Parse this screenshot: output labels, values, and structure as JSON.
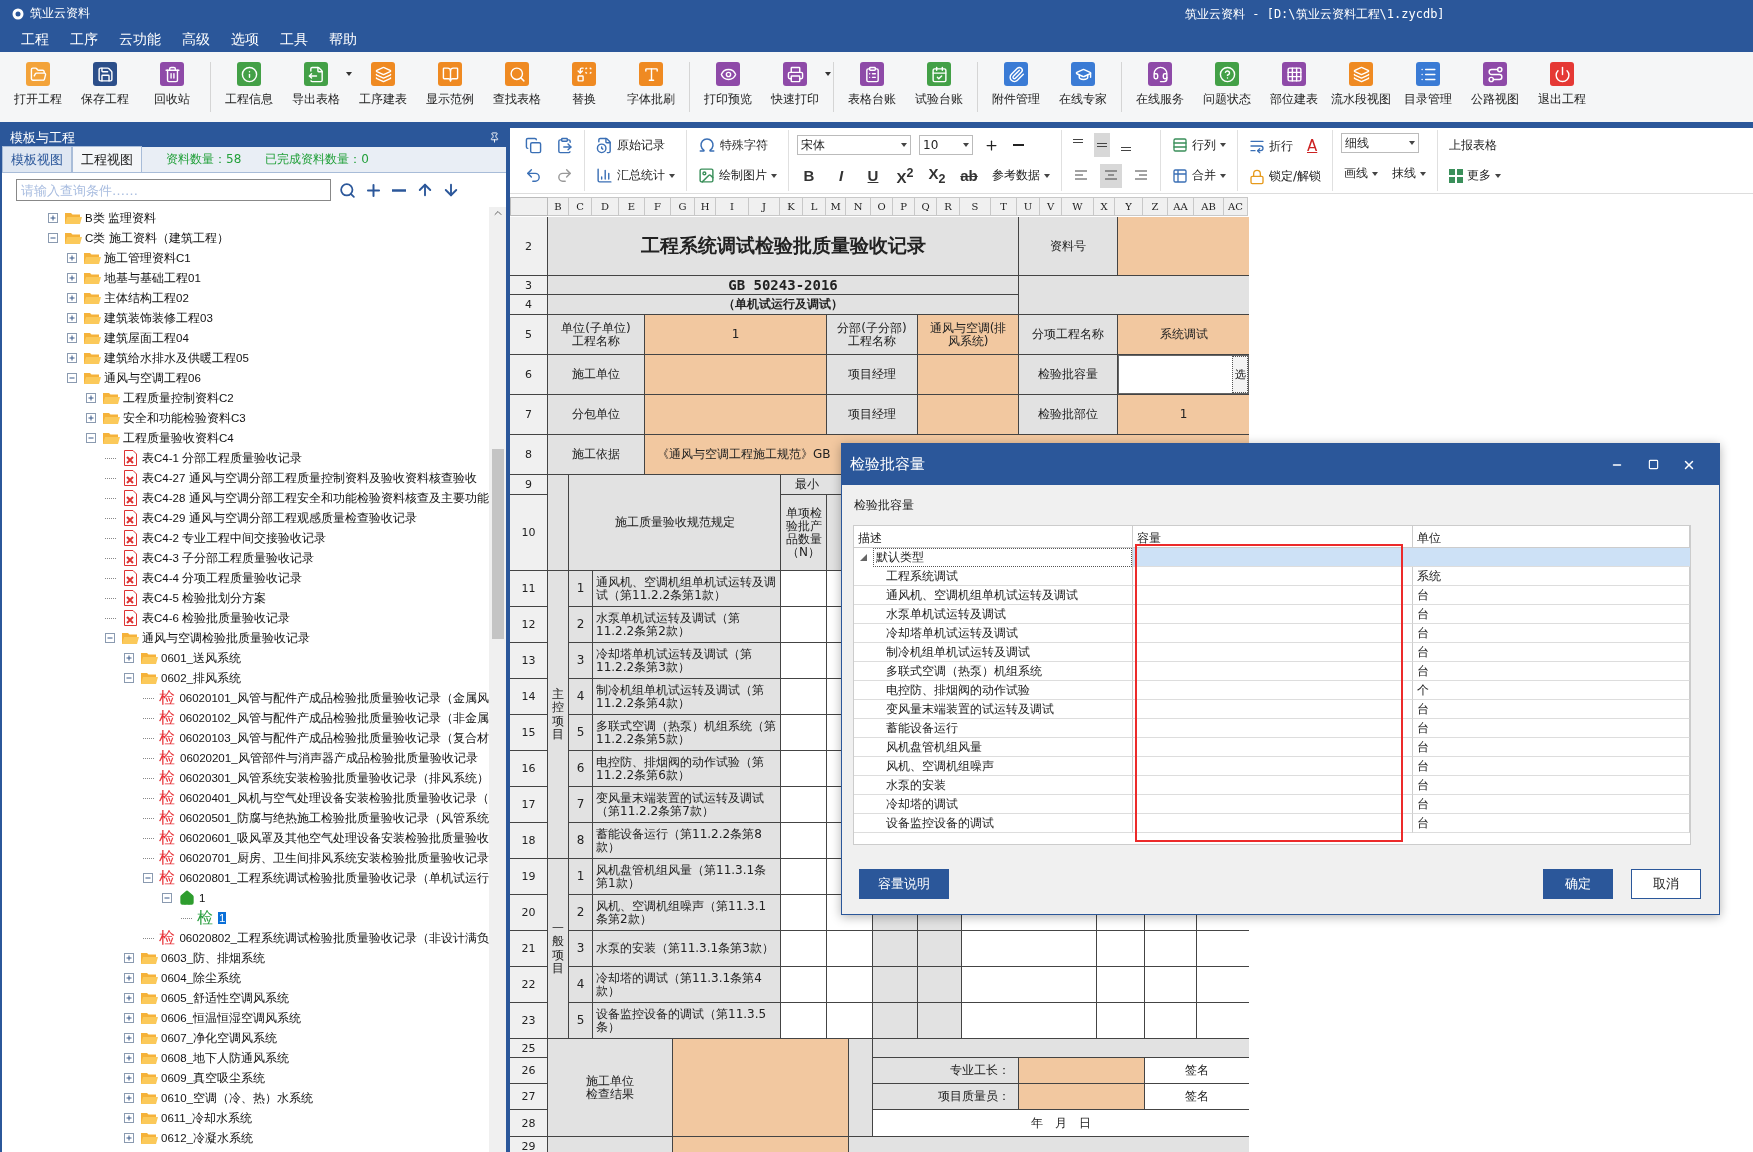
{
  "title_bar": {
    "app_name": "筑业云资料",
    "document": "筑业云资料 - [D:\\筑业云资料工程\\1.zycdb]"
  },
  "menu": [
    "工程",
    "工序",
    "云功能",
    "高级",
    "选项",
    "工具",
    "帮助"
  ],
  "toolbar": [
    {
      "label": "打开工程"
    },
    {
      "label": "保存工程"
    },
    {
      "label": "回收站"
    },
    {
      "label": "工程信息"
    },
    {
      "label": "导出表格",
      "has_menu": true
    },
    {
      "label": "工序建表"
    },
    {
      "label": "显示范例"
    },
    {
      "label": "查找表格"
    },
    {
      "label": "替换"
    },
    {
      "label": "字体批刷"
    },
    {
      "label": "打印预览"
    },
    {
      "label": "快速打印",
      "has_menu": true
    },
    {
      "label": "表格台账"
    },
    {
      "label": "试验台账"
    },
    {
      "label": "附件管理"
    },
    {
      "label": "在线专家"
    },
    {
      "label": "在线服务"
    },
    {
      "label": "问题状态"
    },
    {
      "label": "部位建表"
    },
    {
      "label": "流水段视图"
    },
    {
      "label": "目录管理"
    },
    {
      "label": "公路视图"
    },
    {
      "label": "退出工程"
    }
  ],
  "left_panel": {
    "title": "模板与工程",
    "tabs": [
      {
        "label": "模板视图",
        "selected": true
      },
      {
        "label": "工程视图",
        "selected": false
      }
    ],
    "stats": [
      "资料数量：58",
      "已完成资料数量：0"
    ],
    "search": {
      "placeholder": "请输入查询条件……"
    },
    "tree": [
      {
        "kind": "folder",
        "label": "B类 监理资料",
        "expanded": false,
        "selected": false
      },
      {
        "kind": "folder",
        "label": "C类 施工资料（建筑工程）",
        "expanded": true,
        "selected": false,
        "children": [
          {
            "kind": "folder",
            "label": "施工管理资料C1",
            "expanded": false,
            "selected": false
          },
          {
            "kind": "folder",
            "label": "地基与基础工程01",
            "expanded": false,
            "selected": false
          },
          {
            "kind": "folder",
            "label": "主体结构工程02",
            "expanded": false,
            "selected": false
          },
          {
            "kind": "folder",
            "label": "建筑装饰装修工程03",
            "expanded": false,
            "selected": false
          },
          {
            "kind": "folder",
            "label": "建筑屋面工程04",
            "expanded": false,
            "selected": false
          },
          {
            "kind": "folder",
            "label": "建筑给水排水及供暖工程05",
            "expanded": false,
            "selected": false
          },
          {
            "kind": "folder",
            "label": "通风与空调工程06",
            "expanded": true,
            "selected": false,
            "children": [
              {
                "kind": "folder",
                "label": "工程质量控制资料C2",
                "expanded": false,
                "selected": false
              },
              {
                "kind": "folder",
                "label": "安全和功能检验资料C3",
                "expanded": false,
                "selected": false
              },
              {
                "kind": "folder",
                "label": "工程质量验收资料C4",
                "expanded": true,
                "selected": false,
                "children": [
                  {
                    "kind": "form",
                    "label": "表C4-1 分部工程质量验收记录",
                    "selected": false
                  },
                  {
                    "kind": "form",
                    "label": "表C4-27 通风与空调分部工程质量控制资料及验收资料核查验收",
                    "selected": false
                  },
                  {
                    "kind": "form",
                    "label": "表C4-28 通风与空调分部工程安全和功能检验资料核查及主要功能",
                    "selected": false
                  },
                  {
                    "kind": "form",
                    "label": "表C4-29 通风与空调分部工程观感质量检查验收记录",
                    "selected": false
                  },
                  {
                    "kind": "form",
                    "label": "表C4-2 专业工程中间交接验收记录",
                    "selected": false
                  },
                  {
                    "kind": "form",
                    "label": "表C4-3 子分部工程质量验收记录",
                    "selected": false
                  },
                  {
                    "kind": "form",
                    "label": "表C4-4 分项工程质量验收记录",
                    "selected": false
                  },
                  {
                    "kind": "form",
                    "label": "表C4-5 检验批划分方案",
                    "selected": false
                  },
                  {
                    "kind": "form",
                    "label": "表C4-6 检验批质量验收记录",
                    "selected": false
                  },
                  {
                    "kind": "folder",
                    "label": "通风与空调检验批质量验收记录",
                    "expanded": true,
                    "selected": false,
                    "children": [
                      {
                        "kind": "folder",
                        "label": "0601_送风系统",
                        "expanded": false,
                        "selected": false
                      },
                      {
                        "kind": "folder",
                        "label": "0602_排风系统",
                        "expanded": true,
                        "selected": false,
                        "children": [
                          {
                            "kind": "check",
                            "badge": "检",
                            "color": "#e8343a",
                            "label": "06020101_风管与配件产成品检验批质量验收记录（金属风",
                            "selected": false
                          },
                          {
                            "kind": "check",
                            "badge": "检",
                            "color": "#e8343a",
                            "label": "06020102_风管与配件产成品检验批质量验收记录（非金属",
                            "selected": false
                          },
                          {
                            "kind": "check",
                            "badge": "检",
                            "color": "#e8343a",
                            "label": "06020103_风管与配件产成品检验批质量验收记录（复合材",
                            "selected": false
                          },
                          {
                            "kind": "check",
                            "badge": "检",
                            "color": "#e8343a",
                            "label": "06020201_风管部件与消声器产成品检验批质量验收记录",
                            "selected": false
                          },
                          {
                            "kind": "check",
                            "badge": "检",
                            "color": "#e8343a",
                            "label": "06020301_风管系统安装检验批质量验收记录（排风系统）",
                            "selected": false
                          },
                          {
                            "kind": "check",
                            "badge": "检",
                            "color": "#e8343a",
                            "label": "06020401_风机与空气处理设备安装检验批质量验收记录（",
                            "selected": false
                          },
                          {
                            "kind": "check",
                            "badge": "检",
                            "color": "#e8343a",
                            "label": "06020501_防腐与绝热施工检验批质量验收记录（风管系统",
                            "selected": false
                          },
                          {
                            "kind": "check",
                            "badge": "检",
                            "color": "#e8343a",
                            "label": "06020601_吸风罩及其他空气处理设备安装检验批质量验收",
                            "selected": false
                          },
                          {
                            "kind": "check",
                            "badge": "检",
                            "color": "#e8343a",
                            "label": "06020701_厨房、卫生间排风系统安装检验批质量验收记录",
                            "selected": false
                          },
                          {
                            "kind": "check",
                            "badge": "检",
                            "color": "#e8343a",
                            "label": "06020801_工程系统调试检验批质量验收记录（单机试运行",
                            "expanded": true,
                            "selected": false,
                            "children": [
                              {
                                "kind": "home",
                                "label": "1",
                                "expanded": true,
                                "selected": false,
                                "children": [
                                  {
                                    "kind": "check",
                                    "badge": "检",
                                    "color": "#2ea043",
                                    "label": "1",
                                    "selected": true
                                  }
                                ]
                              }
                            ]
                          },
                          {
                            "kind": "check",
                            "badge": "检",
                            "color": "#e8343a",
                            "label": "06020802_工程系统调试检验批质量验收记录（非设计满负",
                            "selected": false
                          }
                        ]
                      },
                      {
                        "kind": "folder",
                        "label": "0603_防、排烟系统",
                        "expanded": false,
                        "selected": false
                      },
                      {
                        "kind": "folder",
                        "label": "0604_除尘系统",
                        "expanded": false,
                        "selected": false
                      },
                      {
                        "kind": "folder",
                        "label": "0605_舒适性空调风系统",
                        "expanded": false,
                        "selected": false
                      },
                      {
                        "kind": "folder",
                        "label": "0606_恒温恒湿空调风系统",
                        "expanded": false,
                        "selected": false
                      },
                      {
                        "kind": "folder",
                        "label": "0607_净化空调风系统",
                        "expanded": false,
                        "selected": false
                      },
                      {
                        "kind": "folder",
                        "label": "0608_地下人防通风系统",
                        "expanded": false,
                        "selected": false
                      },
                      {
                        "kind": "folder",
                        "label": "0609_真空吸尘系统",
                        "expanded": false,
                        "selected": false
                      },
                      {
                        "kind": "folder",
                        "label": "0610_空调（冷、热）水系统",
                        "expanded": false,
                        "selected": false
                      },
                      {
                        "kind": "folder",
                        "label": "0611_冷却水系统",
                        "expanded": false,
                        "selected": false
                      },
                      {
                        "kind": "folder",
                        "label": "0612_冷凝水系统",
                        "expanded": false,
                        "selected": false
                      }
                    ]
                  }
                ]
              }
            ]
          }
        ]
      }
    ]
  },
  "format_bar": {
    "record": "原始记录",
    "summary": "汇总统计",
    "special_chars": "特殊字符",
    "draw_picture": "绘制图片",
    "font": "宋体",
    "font_size": "10",
    "styles": [
      "B",
      "I",
      "U",
      "X$^{2}$",
      "X$_{2}$",
      "ab"
    ],
    "reference": "参考数据",
    "valign": [
      {
        "selected": false
      },
      {
        "selected": true
      },
      {
        "selected": false
      }
    ],
    "halign": [
      {
        "selected": false
      },
      {
        "selected": true
      },
      {
        "selected": false
      }
    ],
    "row_col": "行列",
    "merge": "合并",
    "wrap": "折行",
    "font_color": "A",
    "lock": "锁定/解锁",
    "line_style": "细线",
    "draw_line": "画线",
    "erase_line": "抹线",
    "report": "上报表格",
    "more": "更多"
  },
  "sheet": {
    "column_letters": [
      "B",
      "C",
      "D",
      "E",
      "F",
      "G",
      "H",
      "I",
      "J",
      "K",
      "L",
      "M",
      "N",
      "O",
      "P",
      "Q",
      "R",
      "S",
      "T",
      "U",
      "V",
      "W",
      "X",
      "Y",
      "Z",
      "AA",
      "AB",
      "AC"
    ],
    "row_numbers": [
      "2",
      "3",
      "4",
      "5",
      "6",
      "7",
      "8",
      "9",
      "10",
      "11",
      "12",
      "13",
      "14",
      "15",
      "16",
      "17",
      "18",
      "19",
      "20",
      "21",
      "22",
      "23",
      "25",
      "26",
      "27",
      "28",
      "29"
    ],
    "title": "工程系统调试检验批质量验收记录",
    "doc_no_label": "资料号",
    "standard": "GB 50243-2016",
    "subtitle": "（单机试运行及调试）",
    "info_rows": [
      [
        {
          "kind": "text",
          "label": "单位(子单位)工程名称",
          "value": "1"
        },
        {
          "kind": "text",
          "label": "分部(子分部)工程名称",
          "value": "通风与空调(排风系统)"
        },
        {
          "kind": "text",
          "label": "分项工程名称",
          "value": "系统调试"
        }
      ],
      [
        {
          "kind": "text",
          "label": "施工单位"
        },
        {
          "kind": "text",
          "label": "项目经理"
        },
        {
          "kind": "picker",
          "label": "检验批容量",
          "button": "选"
        }
      ],
      [
        {
          "kind": "text",
          "label": "分包单位"
        },
        {
          "kind": "text",
          "label": "项目经理"
        },
        {
          "kind": "text",
          "label": "检验批部位",
          "value": "1"
        }
      ]
    ],
    "basis": {
      "label": "施工依据",
      "value": "《通风与空调工程施工规范》GB"
    },
    "spec_header": "施工质量验收规范规定",
    "min_sample_header": "最小",
    "count_header": "单项检验批产品数量（N）",
    "groups": [
      {
        "label": "主控项目",
        "items": [
          {
            "no": "1",
            "text": "通风机、空调机组单机试运转及调试（第11.2.2条第1款）"
          },
          {
            "no": "2",
            "text": "水泵单机试运转及调试（第11.2.2条第2款）"
          },
          {
            "no": "3",
            "text": "冷却塔单机试运转及调试（第11.2.2条第3款）"
          },
          {
            "no": "4",
            "text": "制冷机组单机试运转及调试（第11.2.2条第4款）"
          },
          {
            "no": "5",
            "text": "多联式空调（热泵）机组系统（第11.2.2条第5款）"
          },
          {
            "no": "6",
            "text": "电控防、排烟阀的动作试验（第11.2.2条第6款）"
          },
          {
            "no": "7",
            "text": "变风量末端装置的试运转及调试（第11.2.2条第7款）"
          },
          {
            "no": "8",
            "text": "蓄能设备运行（第11.2.2条第8款）"
          }
        ]
      },
      {
        "label": "一般项目",
        "items": [
          {
            "no": "1",
            "text": "风机盘管机组风量（第11.3.1条第1款）"
          },
          {
            "no": "2",
            "text": "风机、空调机组噪声（第11.3.1条第2款）"
          },
          {
            "no": "3",
            "text": "水泵的安装（第11.3.1条第3款）"
          },
          {
            "no": "4",
            "text": "冷却塔的调试（第11.3.1条第4款）"
          },
          {
            "no": "5",
            "text": "设备监控设备的调试（第11.3.5条）"
          }
        ]
      }
    ],
    "sign_off": {
      "label": "施工单位检查结果",
      "roles": [
        {
          "label": "专业工长：",
          "sign": "签名"
        },
        {
          "label": "项目质量员：",
          "sign": "签名"
        }
      ],
      "date": "年　月　日"
    }
  },
  "dialog": {
    "title": "检验批容量",
    "caption": "检验批容量",
    "columns": [
      {
        "label": "描述",
        "highlighted": false
      },
      {
        "label": "容量",
        "highlighted": true
      },
      {
        "label": "单位",
        "highlighted": false
      }
    ],
    "group": {
      "label": "默认类型",
      "expanded": true,
      "selected": true
    },
    "rows": [
      {
        "description": "工程系统调试",
        "unit": "系统"
      },
      {
        "description": "通风机、空调机组单机试运转及调试",
        "unit": "台"
      },
      {
        "description": "水泵单机试运转及调试",
        "unit": "台"
      },
      {
        "description": "冷却塔单机试运转及调试",
        "unit": "台"
      },
      {
        "description": "制冷机组单机试运转及调试",
        "unit": "台"
      },
      {
        "description": "多联式空调（热泵）机组系统",
        "unit": "台"
      },
      {
        "description": "电控防、排烟阀的动作试验",
        "unit": "个"
      },
      {
        "description": "变风量末端装置的试运转及调试",
        "unit": "台"
      },
      {
        "description": "蓄能设备运行",
        "unit": "台"
      },
      {
        "description": "风机盘管机组风量",
        "unit": "台"
      },
      {
        "description": "风机、空调机组噪声",
        "unit": "台"
      },
      {
        "description": "水泵的安装",
        "unit": "台"
      },
      {
        "description": "冷却塔的调试",
        "unit": "台"
      },
      {
        "description": "设备监控设备的调试",
        "unit": "台"
      }
    ],
    "buttons": [
      {
        "label": "容量说明",
        "kind": "primary"
      },
      {
        "label": "确定",
        "kind": "primary"
      },
      {
        "label": "取消",
        "kind": "secondary"
      }
    ]
  }
}
